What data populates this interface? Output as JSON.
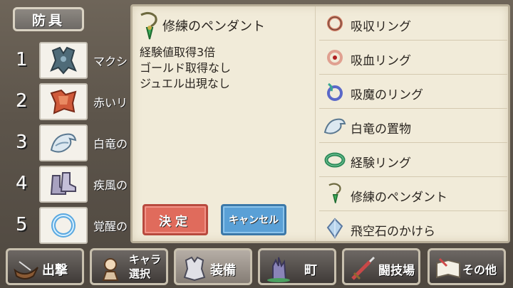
{
  "equipment": {
    "header": "防具",
    "rows": [
      {
        "num": "1",
        "name": "マクシ",
        "icon": "armor-icon"
      },
      {
        "num": "2",
        "name": "赤いリ",
        "icon": "red-cloak-icon"
      },
      {
        "num": "3",
        "name": "白竜の",
        "icon": "white-dragon-icon"
      },
      {
        "num": "4",
        "name": "疾風の",
        "icon": "boots-icon"
      },
      {
        "num": "5",
        "name": "覚醒の",
        "icon": "ring-icon"
      }
    ]
  },
  "detail": {
    "title": "修練のペンダント",
    "lines": [
      "経験値取得3倍",
      "ゴールド取得なし",
      "ジュエル出現なし"
    ],
    "ok_label": "決定",
    "cancel_label": "キャンセル"
  },
  "items": [
    {
      "label": "吸収リング",
      "icon": "absorb-ring-icon"
    },
    {
      "label": "吸血リング",
      "icon": "vampire-ring-icon"
    },
    {
      "label": "吸魔のリング",
      "icon": "mana-ring-icon"
    },
    {
      "label": "白竜の置物",
      "icon": "dragon-figurine-icon"
    },
    {
      "label": "経験リング",
      "icon": "exp-ring-icon"
    },
    {
      "label": "修練のペンダント",
      "icon": "pendant-icon"
    },
    {
      "label": "飛空石のかけら",
      "icon": "crystal-icon"
    }
  ],
  "nav": {
    "sortie": "出撃",
    "chara_line1": "キャラ",
    "chara_line2": "選択",
    "equip": "装備",
    "town": "町",
    "arena": "闘技場",
    "other": "その他"
  },
  "colors": {
    "ok": "#e06b5c",
    "cancel": "#5aa0d6",
    "panel": "#f1ebd9"
  }
}
